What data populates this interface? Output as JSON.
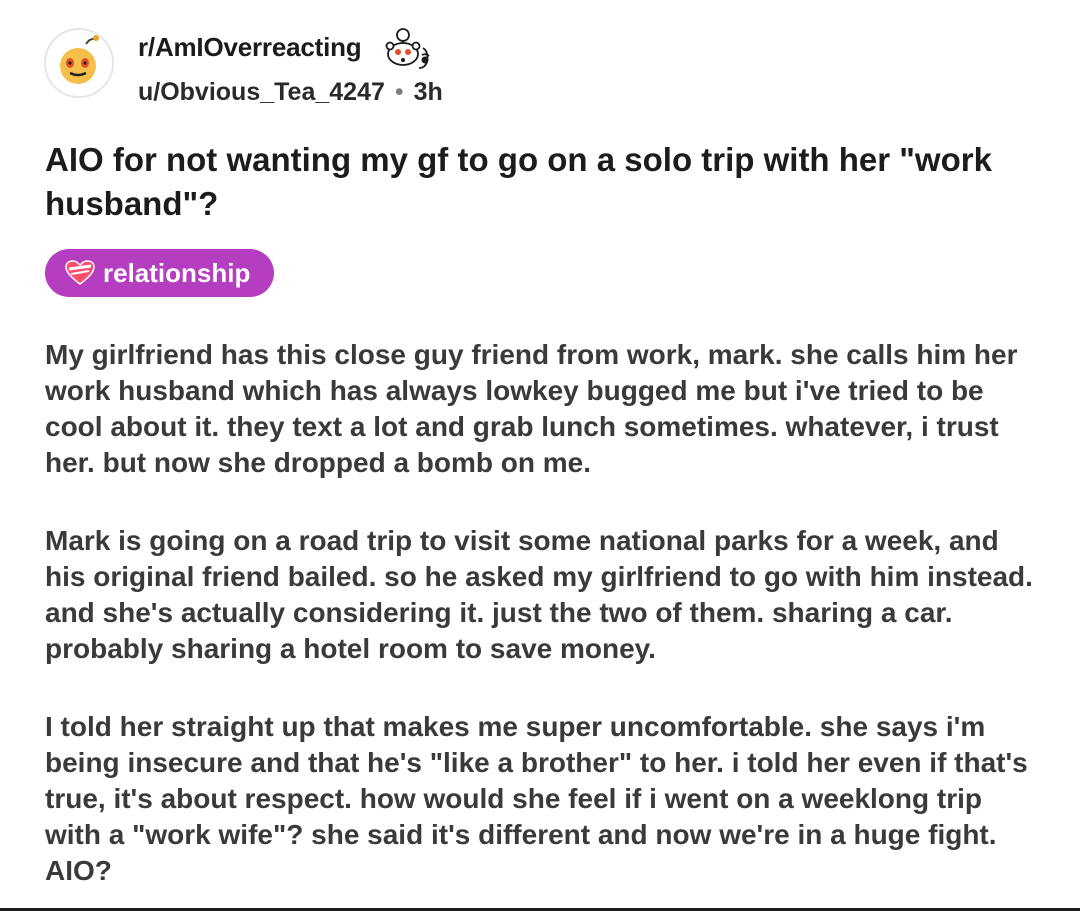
{
  "header": {
    "subreddit": "r/AmIOverreacting",
    "username": "u/Obvious_Tea_4247",
    "separator": "•",
    "age": "3h",
    "avatar_icon": "subreddit-avatar-icon",
    "snoo_icon": "snoo-award-icon"
  },
  "post": {
    "title": "AIO for not wanting my gf to go on a solo trip with her \"work husband\"?",
    "flair": {
      "label": "relationship",
      "icon": "heart-icon",
      "color": "#b53dbf"
    },
    "paragraphs": [
      "My girlfriend has this close guy friend from work, mark. she calls him her work husband which has always lowkey bugged me but i've tried to be cool about it. they text a lot and grab lunch sometimes. whatever, i trust her. but now she dropped a bomb on me.",
      "Mark is going on a road trip to visit some national parks for a week, and his original friend bailed. so he asked my girlfriend to go with him instead. and she's actually considering it. just the two of them. sharing a car. probably sharing a hotel room to save money.",
      "I told her straight up that makes me super uncomfortable. she says i'm being insecure and that he's \"like a brother\" to her. i told her even if that's true, it's about respect. how would she feel if i went on a weeklong trip with a \"work wife\"? she said it's different and now we're in a huge fight. AIO?"
    ]
  }
}
